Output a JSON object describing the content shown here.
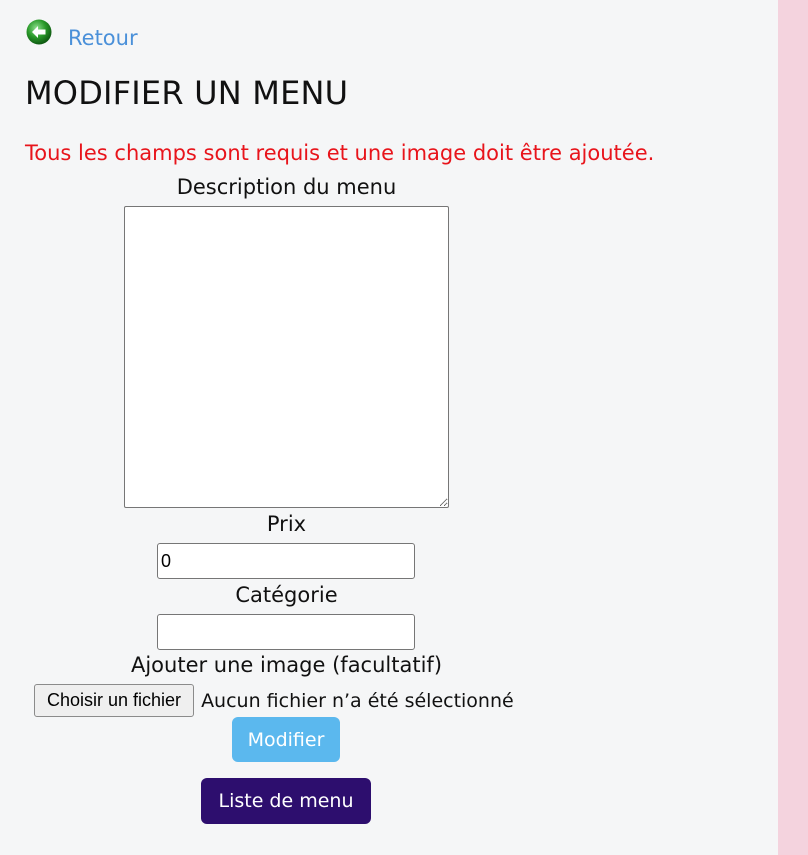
{
  "nav": {
    "back_label": "Retour",
    "back_icon": "back-arrow-icon",
    "back_icon_color": "#2a8c2a"
  },
  "page": {
    "title": "MODIFIER UN MENU",
    "error_message": "Tous les champs sont requis et une image doit être ajoutée."
  },
  "form": {
    "description": {
      "label": "Description du menu",
      "value": ""
    },
    "price": {
      "label": "Prix",
      "value": "0"
    },
    "category": {
      "label": "Catégorie",
      "value": ""
    },
    "image": {
      "label": "Ajouter une image (facultatif)",
      "button_label": "Choisir un fichier",
      "status": "Aucun fichier n’a été sélectionné"
    },
    "submit_label": "Modifier",
    "list_label": "Liste de menu"
  },
  "colors": {
    "link": "#4a90d9",
    "error": "#e8141b",
    "submit_bg": "#5bb8ee",
    "list_bg": "#2d0e6e",
    "right_strip": "#f4d3de"
  }
}
